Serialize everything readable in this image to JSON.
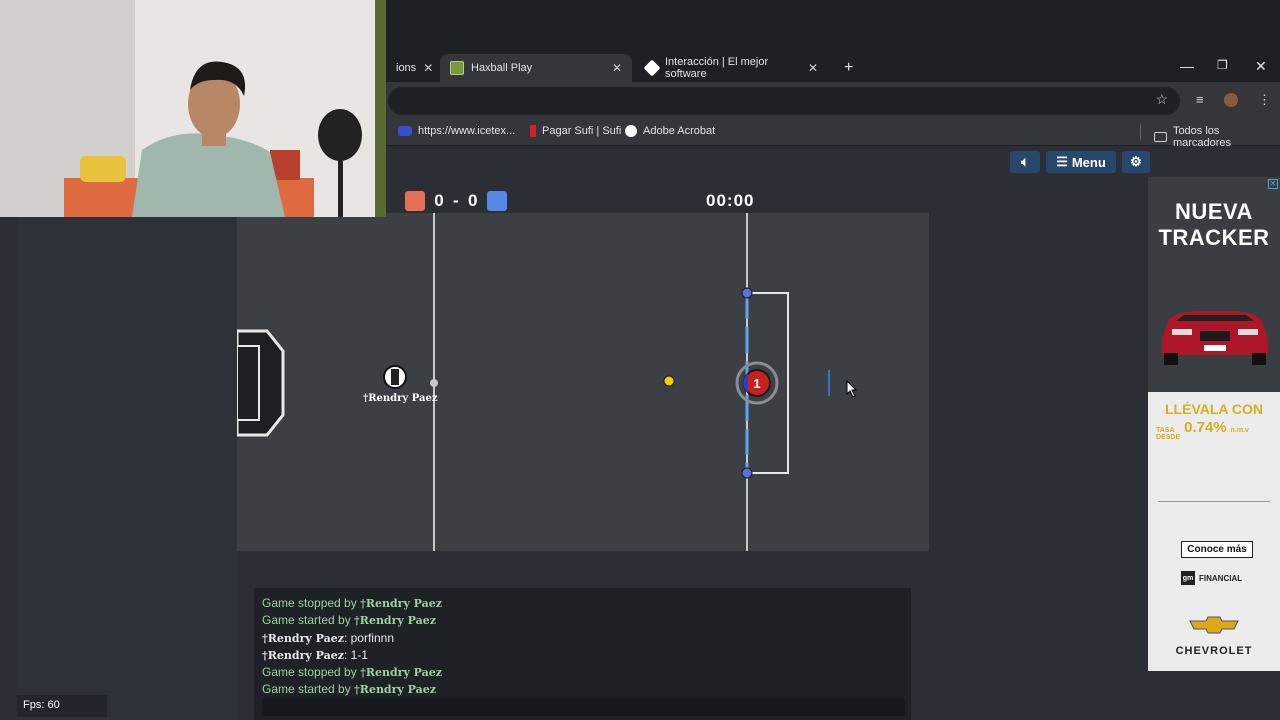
{
  "browser": {
    "tabs": [
      {
        "label": "ions",
        "active": false
      },
      {
        "label": "Haxball Play",
        "active": true
      },
      {
        "label": "Interacción | El mejor software",
        "active": false
      }
    ],
    "new_tab": "+",
    "bookmarks": [
      {
        "label": "https://www.icetex...",
        "icon": "icetex-icon"
      },
      {
        "label": "Pagar Sufi | Sufi",
        "icon": "sufi-icon"
      },
      {
        "label": "Adobe Acrobat",
        "icon": "acrobat-icon"
      }
    ],
    "all_bookmarks": "Todos los marcadores"
  },
  "game": {
    "menu_label": "Menu",
    "score_red": "0",
    "score_sep": "-",
    "score_blue": "0",
    "timer": "00:00",
    "red_player_name": "†Rendry Paez",
    "blue_player_number": "1",
    "colors": {
      "red": "#e56e56",
      "blue": "#5689e5",
      "field": "#3c3f44",
      "ball": "#ffcc00"
    },
    "fps": "Fps: 60"
  },
  "chat": {
    "lines": [
      {
        "type": "system",
        "text": "Game stopped by ",
        "who": "†Rendry Paez"
      },
      {
        "type": "system",
        "text": "Game started by ",
        "who": "†Rendry Paez"
      },
      {
        "type": "message",
        "who": "†Rendry Paez",
        "text": ": porfinnn"
      },
      {
        "type": "message",
        "who": "†Rendry Paez",
        "text": ": 1-1"
      },
      {
        "type": "system",
        "text": "Game stopped by ",
        "who": "†Rendry Paez"
      },
      {
        "type": "system",
        "text": "Game started by ",
        "who": "†Rendry Paez"
      }
    ]
  },
  "ad": {
    "title_line1": "NUEVA",
    "title_line2": "TRACKER",
    "promo": "LLÉVALA CON",
    "rate_prefix_line1": "TASA",
    "rate_prefix_line2": "DESDE",
    "rate": "0.74%",
    "rate_suffix": "n.m.v",
    "cta": "Conoce más",
    "financial": "FINANCIAL",
    "brand": "CHEVROLET"
  }
}
